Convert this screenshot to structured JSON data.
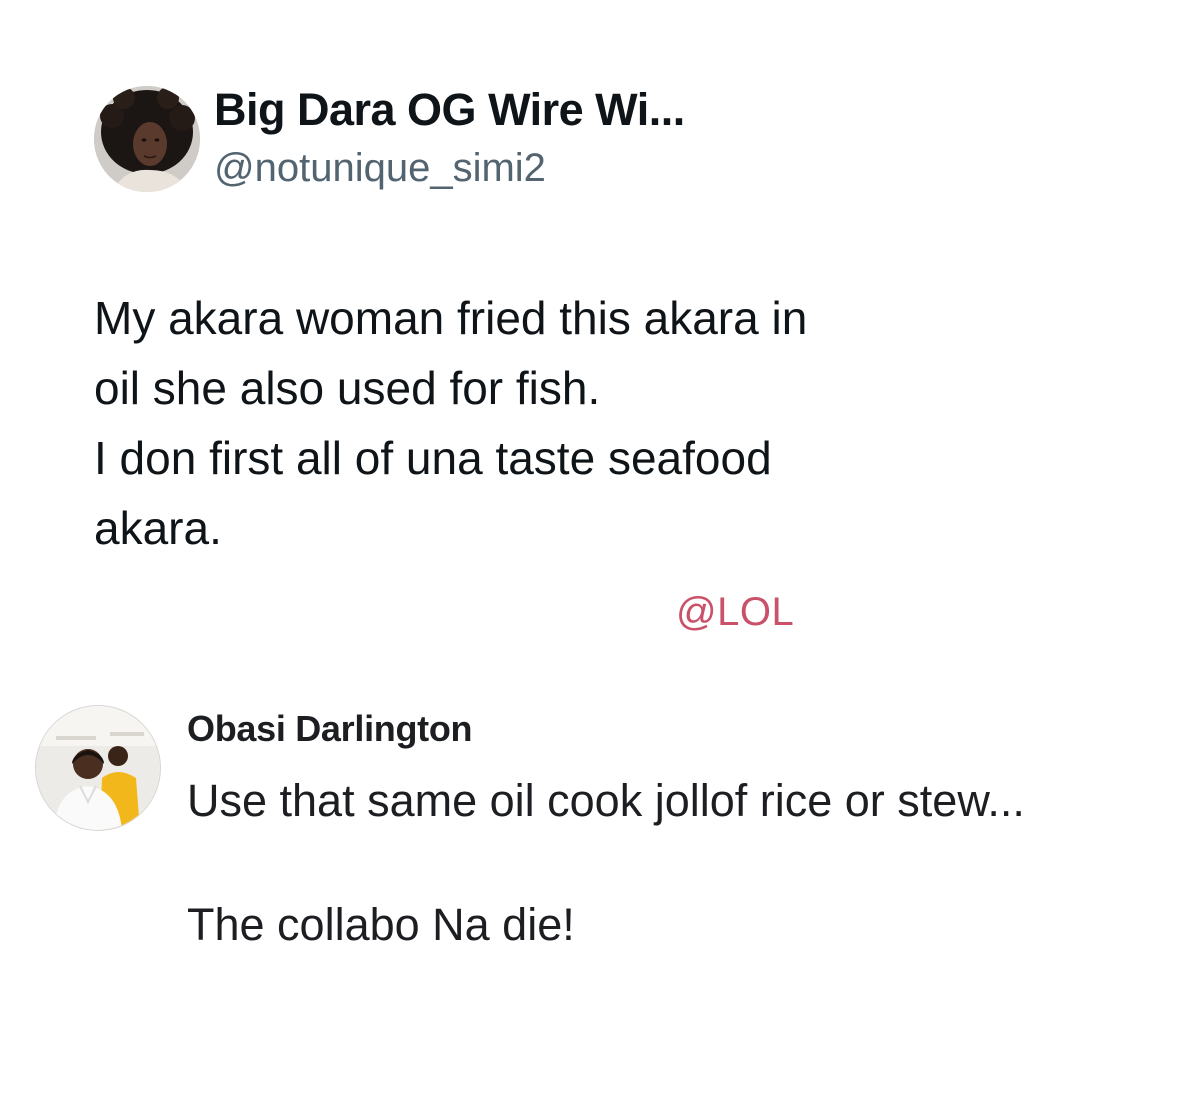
{
  "tweet": {
    "author_name": "Big Dara OG Wire Wi...",
    "author_handle": "@notunique_simi2",
    "avatar_icon": "profile-photo",
    "text_lines": [
      "My akara woman fried this akara in",
      "oil she also used for fish.",
      "I don first all of una taste seafood",
      "akara."
    ]
  },
  "watermark": {
    "text": "@LOL",
    "color": "#c9526a"
  },
  "reply": {
    "author_name": "Obasi Darlington",
    "avatar_icon": "profile-photo",
    "paragraphs": [
      "Use that same oil cook jollof rice or stew...",
      "The collabo Na die!"
    ]
  },
  "colors": {
    "text_primary": "#0f1419",
    "text_secondary": "#536471",
    "background": "#ffffff"
  }
}
